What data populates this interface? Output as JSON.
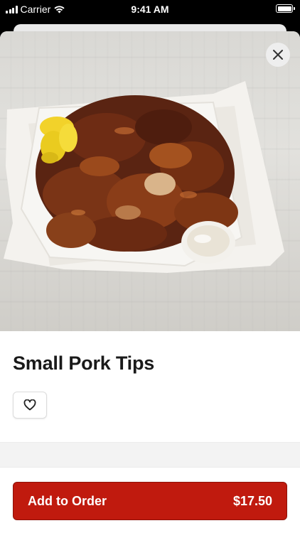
{
  "status_bar": {
    "carrier": "Carrier",
    "time": "9:41 AM"
  },
  "product": {
    "name": "Small Pork Tips",
    "image_icon": "pork-tips-photo"
  },
  "actions": {
    "add_label": "Add to Order",
    "price": "$17.50"
  },
  "colors": {
    "accent": "#c01a0e",
    "accent_border": "#8e1108",
    "title": "#1a1a1a"
  },
  "icons": {
    "close": "close-icon",
    "favorite": "heart-outline-icon",
    "wifi": "wifi-icon",
    "signal": "signal-icon",
    "battery": "battery-icon"
  }
}
